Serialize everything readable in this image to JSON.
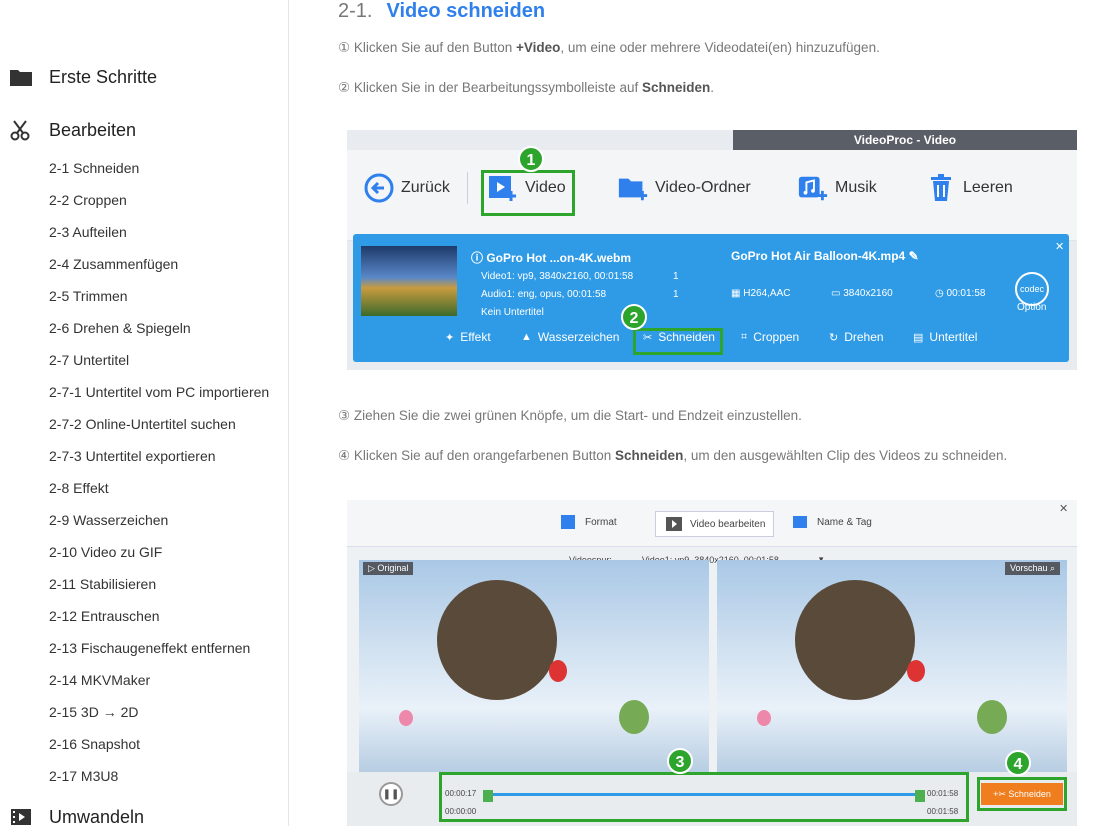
{
  "sidebar": {
    "sections": [
      {
        "icon": "folder-icon",
        "label": "Erste Schritte"
      },
      {
        "icon": "scissors-icon",
        "label": "Bearbeiten"
      },
      {
        "icon": "film-icon",
        "label": "Umwandeln"
      }
    ],
    "items": [
      "2-1 Schneiden",
      "2-2 Croppen",
      "2-3 Aufteilen",
      "2-4 Zusammenfügen",
      "2-5 Trimmen",
      "2-6 Drehen & Spiegeln",
      "2-7 Untertitel",
      "2-7-1 Untertitel vom PC importieren",
      "2-7-2 Online-Untertitel suchen",
      "2-7-3 Untertitel exportieren",
      "2-8 Effekt",
      "2-9 Wasserzeichen",
      "2-10 Video zu GIF",
      "2-11 Stabilisieren",
      "2-12 Entrauschen",
      "2-13 Fischaugeneffekt entfernen",
      "2-14 MKVMaker",
      "2-15 3D → 2D",
      "2-16 Snapshot",
      "2-17 M3U8"
    ]
  },
  "content": {
    "section_number": "2-1.",
    "section_title": "Video schneiden",
    "steps": [
      {
        "pre": "① Klicken Sie auf den Button ",
        "bold": "+Video",
        "post": ", um eine oder mehrere Videodatei(en) hinzuzufügen."
      },
      {
        "pre": "② Klicken Sie in der Bearbeitungssymbolleiste auf ",
        "bold": "Schneiden",
        "post": "."
      },
      {
        "pre": "③ Ziehen Sie die zwei grünen Knöpfe, um die Start- und Endzeit einzustellen.",
        "bold": "",
        "post": ""
      },
      {
        "pre": "④ Klicken Sie auf den orangefarbenen Button ",
        "bold": "Schneiden",
        "post": ", um den ausgewählten Clip des Videos zu schneiden."
      }
    ]
  },
  "shot1": {
    "window_title": "VideoProc - Video",
    "toolbar": {
      "back": "Zurück",
      "video": "Video",
      "folder": "Video-Ordner",
      "music": "Musik",
      "clear": "Leeren"
    },
    "badge1": "1",
    "badge2": "2",
    "file": {
      "source_name": "GoPro Hot ...on-4K.webm",
      "video_info": "Video1: vp9, 3840x2160, 00:01:58",
      "audio_info": "Audio1: eng, opus, 00:01:58",
      "subtitle_info": "Kein Untertitel",
      "count1": "1",
      "count2": "1",
      "output_name": "GoPro Hot Air Balloon-4K.mp4",
      "codec": "H264,AAC",
      "resolution": "3840x2160",
      "duration": "00:01:58",
      "codec_icon_text": "codec",
      "option_label": "Option"
    },
    "edit_bar": {
      "effect": "Effekt",
      "watermark": "Wasserzeichen",
      "cut": "Schneiden",
      "crop": "Croppen",
      "rotate": "Drehen",
      "subtitle": "Untertitel"
    }
  },
  "shot2": {
    "tabs": {
      "format": "Format",
      "edit_video": "Video bearbeiten",
      "name_tag": "Name & Tag"
    },
    "track_label": "Videospur:",
    "track_value": "Video1: vp9, 3840x2160, 00:01:58",
    "original_label": "Original",
    "preview_label": "Vorschau",
    "start_top": "00:00:17",
    "start_bottom": "00:00:00",
    "end_top": "00:01:58",
    "end_bottom": "00:01:58",
    "badge3": "3",
    "badge4": "4",
    "cut_button": "Schneiden"
  }
}
